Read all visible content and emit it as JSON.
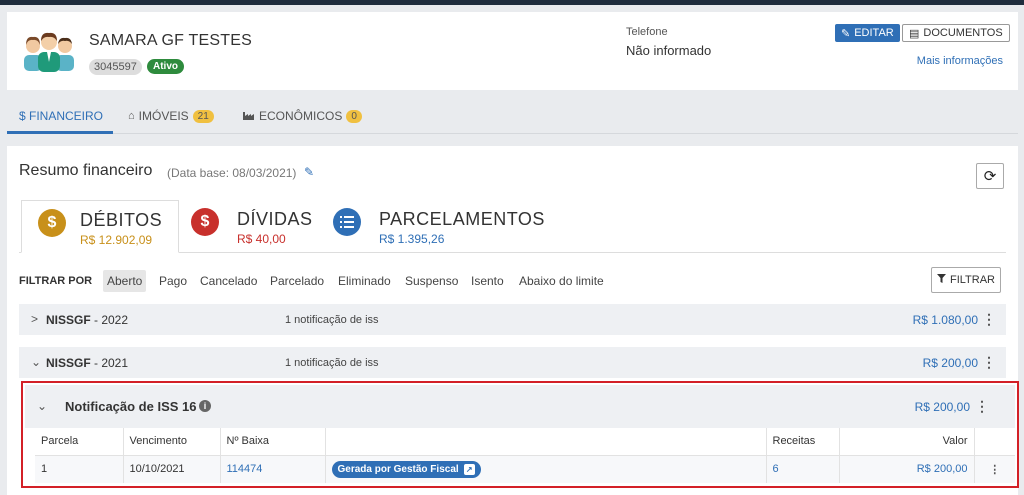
{
  "header": {
    "name": "SAMARA GF TESTES",
    "id_badge": "3045597",
    "status_badge": "Ativo",
    "phone_label": "Telefone",
    "phone_value": "Não informado",
    "edit_label": "EDITAR",
    "documents_label": "DOCUMENTOS",
    "more_info": "Mais informações"
  },
  "tabs": [
    {
      "label": "$ FINANCEIRO",
      "icon": "dollar-icon",
      "count": null
    },
    {
      "label": "IMÓVEIS",
      "icon": "home-icon",
      "count": "21"
    },
    {
      "label": "ECONÔMICOS",
      "icon": "industry-icon",
      "count": "0"
    }
  ],
  "summary": {
    "title": "Resumo financeiro",
    "base_date": "(Data base: 08/03/2021)",
    "cards": [
      {
        "label": "DÉBITOS",
        "value": "R$ 12.902,09",
        "icon": "dollar-circle-icon",
        "color": "#c8901a"
      },
      {
        "label": "DÍVIDAS",
        "value": "R$ 40,00",
        "icon": "dollar-circle-icon",
        "color": "#c8302c"
      },
      {
        "label": "PARCELAMENTOS",
        "value": "R$ 1.395,26",
        "icon": "list-circle-icon",
        "color": "#2f6fb6"
      }
    ]
  },
  "filters": {
    "label": "FILTRAR POR",
    "chips": [
      "Aberto",
      "Pago",
      "Cancelado",
      "Parcelado",
      "Eliminado",
      "Suspenso",
      "Isento",
      "Abaixo do limite"
    ],
    "active": "Aberto",
    "button": "FILTRAR"
  },
  "groups": [
    {
      "name": "NISSGF",
      "year": " - 2022",
      "note": "1 notificação de iss",
      "amount": "R$ 1.080,00",
      "expanded": false
    },
    {
      "name": "NISSGF",
      "year": " - 2021",
      "note": "1 notificação de iss",
      "amount": "R$ 200,00",
      "expanded": true
    }
  ],
  "detail": {
    "title": "Notificação de ISS 16",
    "amount": "R$ 200,00",
    "columns": [
      "Parcela",
      "Vencimento",
      "Nº Baixa",
      "",
      "Receitas",
      "Valor",
      ""
    ],
    "row": {
      "parcela": "1",
      "vencimento": "10/10/2021",
      "baixa": "114474",
      "tag": "Gerada por Gestão Fiscal",
      "receitas": "6",
      "valor": "R$ 200,00"
    }
  }
}
